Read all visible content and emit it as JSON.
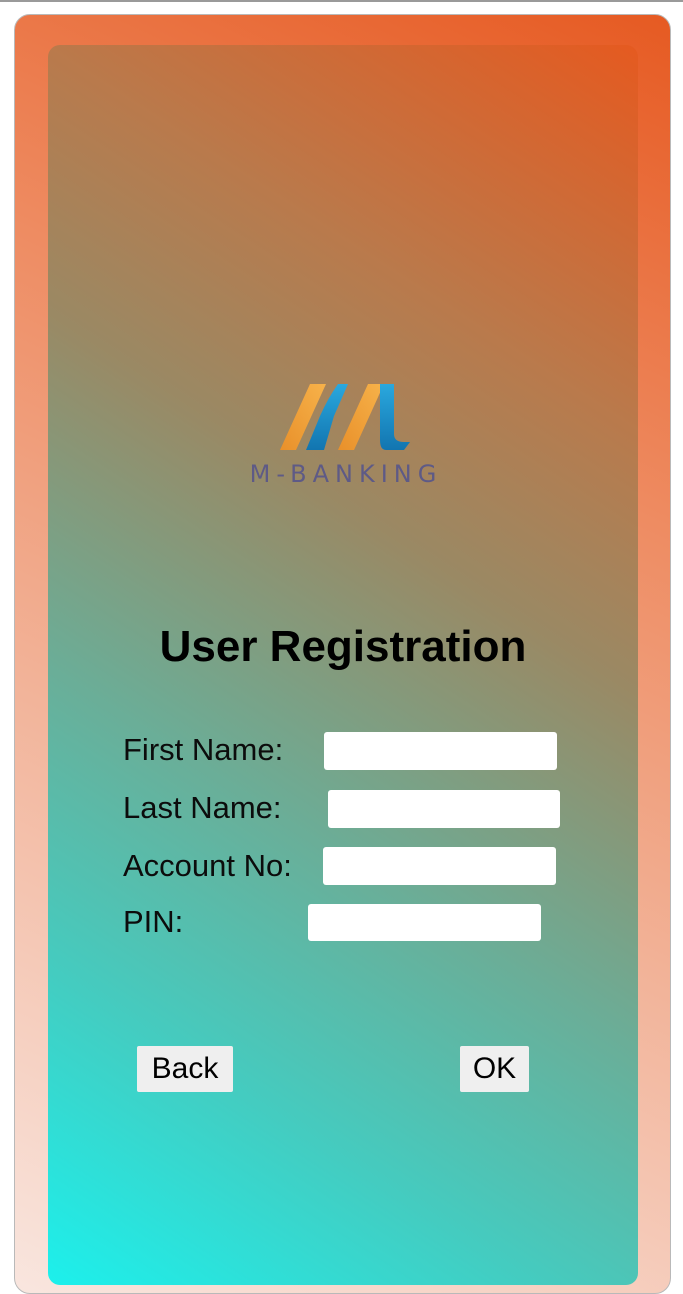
{
  "app": {
    "brand": "M-BANKING"
  },
  "form": {
    "title": "User Registration",
    "fields": [
      {
        "label": "First Name:",
        "value": "",
        "placeholder": ""
      },
      {
        "label": "Last Name:",
        "value": "",
        "placeholder": ""
      },
      {
        "label": "Account No:",
        "value": "",
        "placeholder": ""
      },
      {
        "label": "PIN:",
        "value": "",
        "placeholder": ""
      }
    ]
  },
  "buttons": {
    "back_label": "Back",
    "ok_label": "OK"
  },
  "colors": {
    "frame_orange": "#e65a22",
    "panel_cyan": "#1cf0ec",
    "logo_orange": "#f0a03a",
    "logo_blue": "#1f9fd6",
    "brand_text": "#5e5a86"
  },
  "icons": {
    "logo": "m-banking-logo-mark"
  }
}
